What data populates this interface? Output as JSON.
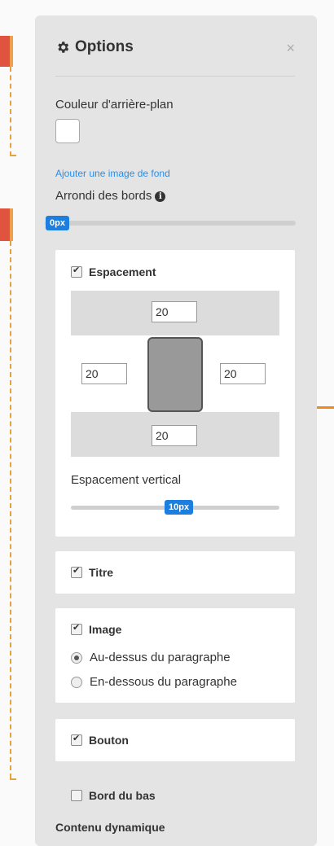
{
  "panel": {
    "title": "Options",
    "close": "×",
    "bg_color_label": "Couleur d'arrière-plan",
    "bg_color_value": "#ffffff",
    "add_bg_image_link": "Ajouter une image de fond",
    "border_radius_label": "Arrondi des bords",
    "border_radius_value": "0px"
  },
  "spacing": {
    "label": "Espacement",
    "checked": true,
    "top": "20",
    "left": "20",
    "right": "20",
    "bottom": "20",
    "vertical_label": "Espacement vertical",
    "vertical_value": "10px"
  },
  "title_section": {
    "label": "Titre",
    "checked": true
  },
  "image_section": {
    "label": "Image",
    "checked": true,
    "options": [
      "Au-dessus du paragraphe",
      "En-dessous du paragraphe"
    ],
    "selected": "Au-dessus du paragraphe"
  },
  "button_section": {
    "label": "Bouton",
    "checked": true
  },
  "bottom_border": {
    "label": "Bord du bas",
    "checked": false
  },
  "dynamic_content": {
    "label": "Contenu dynamique"
  },
  "colors": {
    "accent": "#1c7fe0",
    "link": "#2a8ee6",
    "orange": "#f08a16"
  }
}
